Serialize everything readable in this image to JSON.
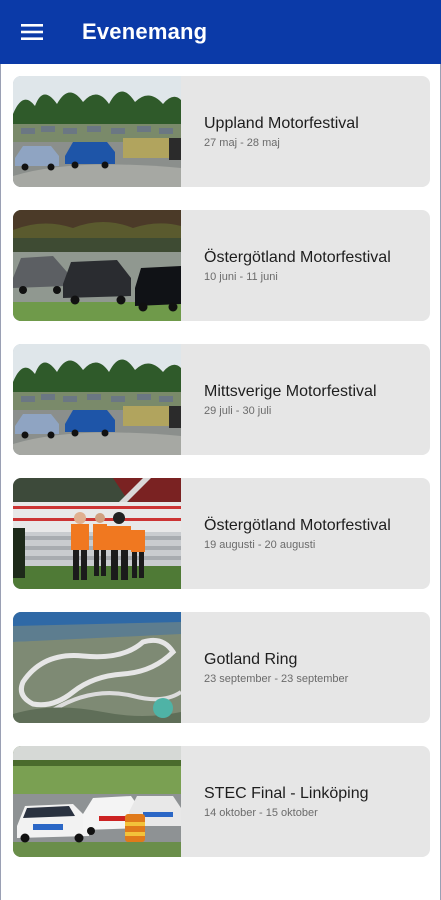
{
  "app": {
    "title": "Evenemang",
    "menu_icon": "hamburger-menu-icon",
    "accent": "#0b3aa8"
  },
  "events": [
    {
      "name": "Uppland Motorfestival",
      "dates": "27 maj - 28 maj",
      "image": "parked-cars-track"
    },
    {
      "name": "Östergötland Motorfestival",
      "dates": "10 juni - 11 juni",
      "image": "cars-on-track"
    },
    {
      "name": "Mittsverige Motorfestival",
      "dates": "29 juli - 30 juli",
      "image": "parked-cars-track"
    },
    {
      "name": "Östergötland Motorfestival",
      "dates": "19 augusti - 20 augusti",
      "image": "track-marshals"
    },
    {
      "name": "Gotland Ring",
      "dates": "23 september - 23 september",
      "image": "aerial-circuit"
    },
    {
      "name": "STEC Final - Linköping",
      "dates": "14 oktober - 15 oktober",
      "image": "racing-cars"
    }
  ]
}
